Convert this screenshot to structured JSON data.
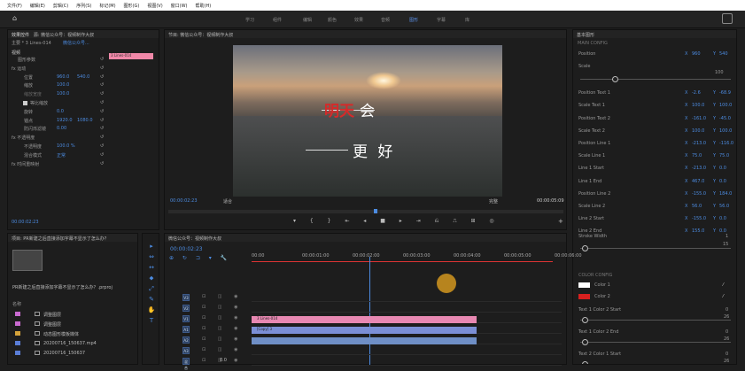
{
  "menu": [
    "文件(F)",
    "编辑(E)",
    "剪辑(C)",
    "序列(S)",
    "标记(M)",
    "图形(G)",
    "视图(V)",
    "窗口(W)",
    "帮助(H)"
  ],
  "workspaces": [
    "学习",
    "组件",
    "编辑",
    "颜色",
    "效果",
    "音频",
    "图形",
    "字幕",
    "库"
  ],
  "active_workspace": "图形",
  "effect_controls": {
    "tab1": "效果控件",
    "tab2": "音频剪辑混合器",
    "tab2_label": "源: 微信公众号：视频制作大叔",
    "source_label": "主要 * 3 Lines-014",
    "clip_label": "微信公众号...",
    "clip_bar": "3 Lines-014",
    "video_label": "视频",
    "items": [
      {
        "name": "图形参数",
        "indent": 1
      },
      {
        "name": "fx 运动",
        "indent": 0
      },
      {
        "name": "位置",
        "v1": "960.0",
        "v2": "540.0",
        "indent": 2
      },
      {
        "name": "缩放",
        "v1": "100.0",
        "indent": 2
      },
      {
        "name": "缩放宽度",
        "v1": "100.0",
        "indent": 2,
        "dim": true
      },
      {
        "name": "等比缩放",
        "checkbox": true,
        "indent": 3
      },
      {
        "name": "旋转",
        "v1": "0.0",
        "indent": 2
      },
      {
        "name": "锚点",
        "v1": "1920.0",
        "v2": "1080.0",
        "indent": 2
      },
      {
        "name": "防闪烁滤镜",
        "v1": "0.00",
        "indent": 2
      },
      {
        "name": "fx 不透明度",
        "indent": 0
      },
      {
        "name": "不透明度",
        "v1": "100.0 %",
        "indent": 2
      },
      {
        "name": "混合模式",
        "v1": "正常",
        "indent": 2
      },
      {
        "name": "fx 时间重映射",
        "indent": 0
      }
    ],
    "timecode": "00:00:02:23"
  },
  "program": {
    "title": "节目: 微信公众号：视频制作大叔",
    "title_red": "明天",
    "title_white": "会",
    "subtitle": "更 好",
    "timecode_left": "00:00:02:23",
    "fit": "适合",
    "quality": "完整",
    "timecode_right": "00:00:05:09"
  },
  "project": {
    "title": "项目: PR新建之后直接添加字幕不显示了怎么办？",
    "clip_name": "PR新建之后直接添加字幕不显示了怎么办？.prproj",
    "count": "1 项已选择，共 8 项",
    "name_header": "名称",
    "files": [
      {
        "name": "调整图层",
        "color": "#c96ad0"
      },
      {
        "name": "调整图层",
        "color": "#c96ad0"
      },
      {
        "name": "动态图形模板媒体",
        "color": "#d4a23a"
      },
      {
        "name": "20200716_150637.mp4",
        "color": "#5a7dd6"
      },
      {
        "name": "20200716_150637",
        "color": "#5a7dd6"
      }
    ]
  },
  "timeline": {
    "title": "微信公众号：视频制作大叔",
    "timecode": "00:00:02:23",
    "ruler": [
      "00:00",
      "00:00:01:00",
      "00:00:02:00",
      "00:00:03:00",
      "00:00:04:00",
      "00:00:05:00",
      "00:00:06:00"
    ],
    "tracks": [
      {
        "name": "V3",
        "clip": "",
        "color": ""
      },
      {
        "name": "V2",
        "clip": "",
        "color": ""
      },
      {
        "name": "V1",
        "clip": "3 Lines-014",
        "color": "#e888b2"
      },
      {
        "name": "A1",
        "clip": "[Copy] 3",
        "color": "#7b8fd6"
      },
      {
        "name": "A2",
        "clip": "",
        "color": "#6f8fc6"
      },
      {
        "name": "A3",
        "clip": "",
        "color": ""
      },
      {
        "name": "混合",
        "clip": "",
        "color": ""
      }
    ],
    "mix_value": "0.0"
  },
  "essential": {
    "title": "基本图形",
    "main_config": "MAIN CONFIG",
    "params": [
      {
        "name": "Position",
        "x": "960",
        "y": "540"
      },
      {
        "name": "Scale",
        "x": "",
        "y": "100",
        "slider": true
      },
      {
        "name": "Position Text 1",
        "x": "-2.6",
        "y": "-68.9"
      },
      {
        "name": "Scale Text 1",
        "x": "100.0",
        "y": "100.0"
      },
      {
        "name": "Position Text 2",
        "x": "-161.0",
        "y": "-45.0"
      },
      {
        "name": "Scale Text 2",
        "x": "100.0",
        "y": "100.0"
      },
      {
        "name": "Position Line 1",
        "x": "-213.0",
        "y": "-116.0"
      },
      {
        "name": "Scale Line 1",
        "x": "75.0",
        "y": "75.0"
      },
      {
        "name": "Line 1 Start",
        "x": "-213.0",
        "y": "0.0"
      },
      {
        "name": "Line 1 End",
        "x": "467.0",
        "y": "0.0"
      },
      {
        "name": "Position Line 2",
        "x": "-155.0",
        "y": "184.0"
      },
      {
        "name": "Scale Line 2",
        "x": "56.0",
        "y": "56.0"
      },
      {
        "name": "Line 2 Start",
        "x": "-155.0",
        "y": "0.0"
      },
      {
        "name": "Line 2 End",
        "x": "155.0",
        "y": "0.0"
      }
    ],
    "stroke_width": "Stroke Width",
    "stroke_value": "1",
    "stroke_max": "15",
    "color_config": "COLOR CONFIG",
    "colors": [
      {
        "name": "Color 1",
        "swatch": "#ffffff"
      },
      {
        "name": "Color 2",
        "swatch": "#d7201f"
      }
    ],
    "bottom": [
      {
        "name": "Text 1 Color 2 Start",
        "v": "0",
        "max": "26"
      },
      {
        "name": "Text 1 Color 2 End",
        "v": "0",
        "max": "26"
      },
      {
        "name": "Text 2 Color 1 Start",
        "v": "0",
        "max": "26"
      }
    ]
  }
}
